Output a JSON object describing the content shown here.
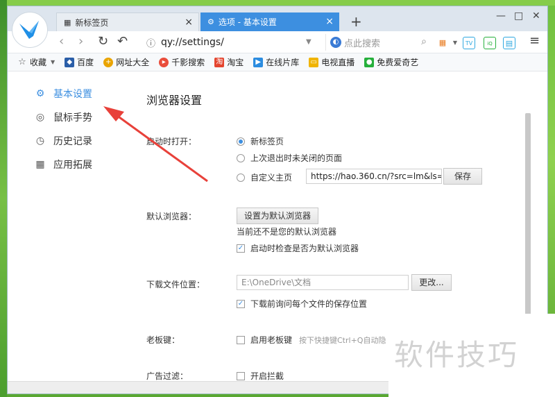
{
  "tabs": {
    "newtab_label": "新标签页",
    "settings_label": "选项 - 基本设置",
    "close_glyph": "×",
    "newtab_glyph": "+"
  },
  "window_controls": {
    "minimize": "—",
    "maximize": "□",
    "close": "✕"
  },
  "nav": {
    "back": "‹",
    "forward": "›",
    "refresh": "↻",
    "undo": "↶",
    "url": "qy://settings/",
    "search_placeholder": "点此搜索",
    "menu": "≡"
  },
  "bookmarks": [
    {
      "label": "收藏",
      "icon": "star-icon",
      "color": "#ffffff"
    },
    {
      "label": "百度",
      "icon": "baidu-icon",
      "color": "#2a5ea8"
    },
    {
      "label": "网址大全",
      "icon": "sitelist-icon",
      "color": "#e9a400"
    },
    {
      "label": "千影搜索",
      "icon": "qianying-icon",
      "color": "#e94e3c"
    },
    {
      "label": "淘宝",
      "icon": "taobao-icon",
      "color": "#e4452f"
    },
    {
      "label": "在线片库",
      "icon": "film-icon",
      "color": "#2b8ce0"
    },
    {
      "label": "电视直播",
      "icon": "tv-icon",
      "color": "#f0b400"
    },
    {
      "label": "免费爱奇艺",
      "icon": "iqiyi-icon",
      "color": "#26b03c"
    }
  ],
  "sidebar": {
    "items": [
      {
        "label": "基本设置",
        "icon": "gear-icon",
        "glyph": "⚙"
      },
      {
        "label": "鼠标手势",
        "icon": "mouse-icon",
        "glyph": "◎"
      },
      {
        "label": "历史记录",
        "icon": "clock-icon",
        "glyph": "◷"
      },
      {
        "label": "应用拓展",
        "icon": "apps-icon",
        "glyph": "▦"
      }
    ]
  },
  "main": {
    "title": "浏览器设置",
    "startup": {
      "label": "启动时打开：",
      "options": [
        "新标签页",
        "上次退出时未关闭的页面",
        "自定义主页"
      ],
      "selected": 0,
      "homepage_value": "https://hao.360.cn/?src=lm&ls=n",
      "save_button": "保存"
    },
    "default_browser": {
      "label": "默认浏览器：",
      "button": "设置为默认浏览器",
      "status": "当前还不是您的默认浏览器",
      "check_label": "启动时检查是否为默认浏览器",
      "checked": true
    },
    "download": {
      "label": "下载文件位置：",
      "path": "E:\\OneDrive\\文档",
      "change_button": "更改...",
      "ask_label": "下载前询问每个文件的保存位置",
      "ask_checked": true
    },
    "boss_key": {
      "label": "老板键：",
      "check_label": "启用老板键",
      "hint": "按下快捷键Ctrl+Q自动隐"
    },
    "ad_filter": {
      "label": "广告过滤：",
      "check_label": "开启拦截"
    }
  },
  "watermark": "软件技巧",
  "colors": {
    "accent": "#3d8fe0",
    "arrow": "#e8413a"
  }
}
